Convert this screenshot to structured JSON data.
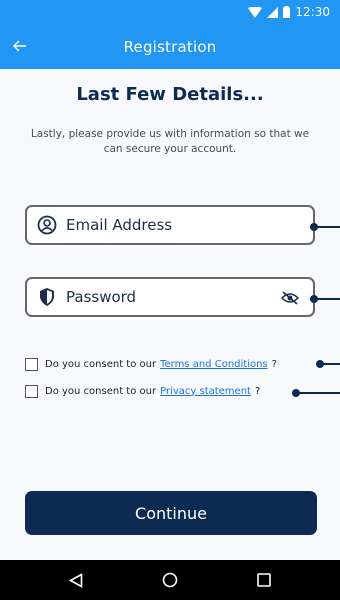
{
  "status_bar": {
    "time": "12:30",
    "icons": [
      "wifi-icon",
      "cell-signal-icon",
      "battery-icon"
    ]
  },
  "app_bar": {
    "title": "Registration",
    "back_icon": "back-arrow-icon",
    "background": "#2196f3"
  },
  "main": {
    "heading": "Last Few Details...",
    "subtext": "Lastly, please provide us with information so that we can secure your account.",
    "email": {
      "placeholder": "Email Address",
      "icon": "user-circle-icon"
    },
    "password": {
      "placeholder": "Password",
      "icon": "shield-icon",
      "toggle_icon": "eye-off-icon"
    },
    "consents": [
      {
        "prefix": "Do you consent to our",
        "link": "Terms and Conditions",
        "suffix": "?",
        "checked": false
      },
      {
        "prefix": "Do you consent to our",
        "link": "Privacy statement",
        "suffix": "?",
        "checked": false
      }
    ],
    "continue_label": "Continue"
  },
  "colors": {
    "primary_dark": "#0d2b52",
    "link": "#1a73e8"
  },
  "nav_bar": {
    "icons": [
      "back-triangle-icon",
      "home-circle-icon",
      "recents-square-icon"
    ]
  }
}
